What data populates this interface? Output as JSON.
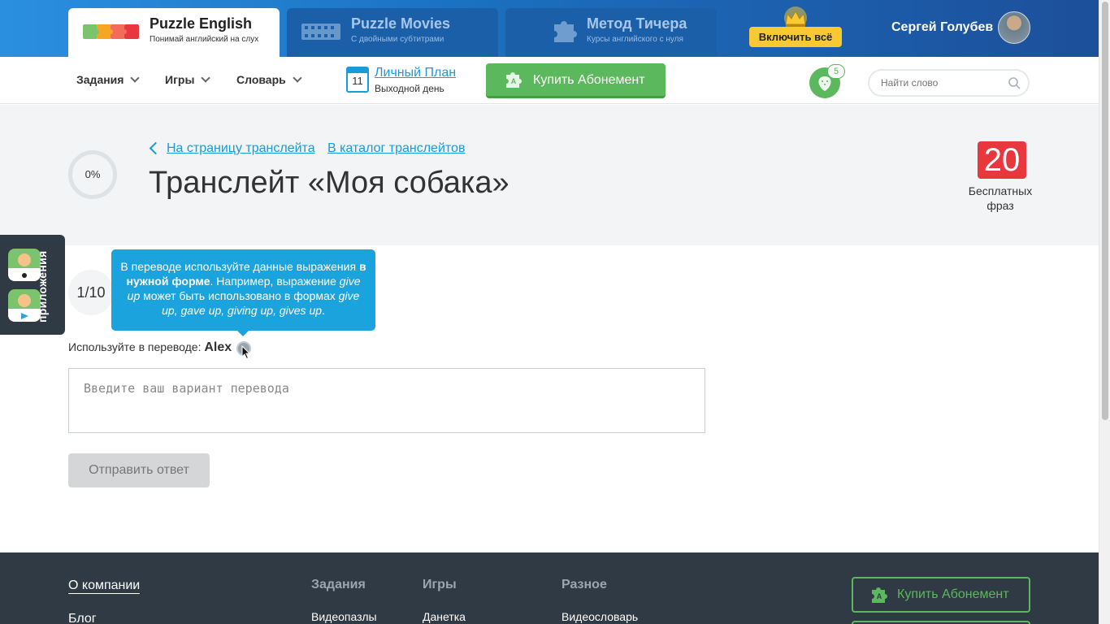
{
  "brand": {
    "tabs": [
      {
        "name": "Puzzle English",
        "subtitle": "Понимай английский на слух"
      },
      {
        "name": "Puzzle Movies",
        "subtitle": "С двойными субтитрами"
      },
      {
        "name": "Метод Тичера",
        "subtitle": "Курсы английского с нуля"
      }
    ],
    "include_all_label": "Включить всё",
    "user_name": "Сергей Голубев"
  },
  "nav": {
    "items": [
      {
        "label": "Задания"
      },
      {
        "label": "Игры"
      },
      {
        "label": "Словарь"
      }
    ],
    "calendar_day": "11",
    "plan_label": "Личный План",
    "plan_status": "Выходной день",
    "buy_label": "Купить Абонемент",
    "berries_count": "5",
    "search_placeholder": "Найти слово"
  },
  "header": {
    "progress": "0%",
    "breadcrumbs": [
      {
        "label": "На страницу транслейта"
      },
      {
        "label": "В каталог транслейтов"
      }
    ],
    "title": "Транслейт «Моя собака»",
    "free_phrases_count": "20",
    "free_phrases_label": "Бесплатных фраз"
  },
  "side_apps": {
    "label": "приложения"
  },
  "task": {
    "step": "1/10",
    "tooltip": {
      "part1": "В переводе используйте данные выражения ",
      "bold": "в нужной форме",
      "part2": ". Например, выражение ",
      "ital1": "give up",
      "part3": " может быть использовано в формах ",
      "ital2": "give up, gave up, giving up, gives up",
      "part4": "."
    },
    "hint_prefix": "Используйте в переводе: ",
    "hint_word": "Alex",
    "answer_placeholder": "Введите ваш вариант перевода",
    "submit_label": "Отправить ответ"
  },
  "footer": {
    "about": "О компании",
    "blog": "Блог",
    "columns": [
      {
        "title": "Задания",
        "first_link": "Видеопазлы"
      },
      {
        "title": "Игры",
        "first_link": "Данетка"
      },
      {
        "title": "Разное",
        "first_link": "Видеословарь"
      }
    ],
    "buy_label": "Купить Абонемент"
  },
  "colors": {
    "brand_blue": "#1b6fbf",
    "accent_blue": "#1a9ad6",
    "green": "#5cb85c",
    "red_badge": "#e8383d",
    "gold": "#f9c933",
    "footer_bg": "#2f3a44"
  }
}
